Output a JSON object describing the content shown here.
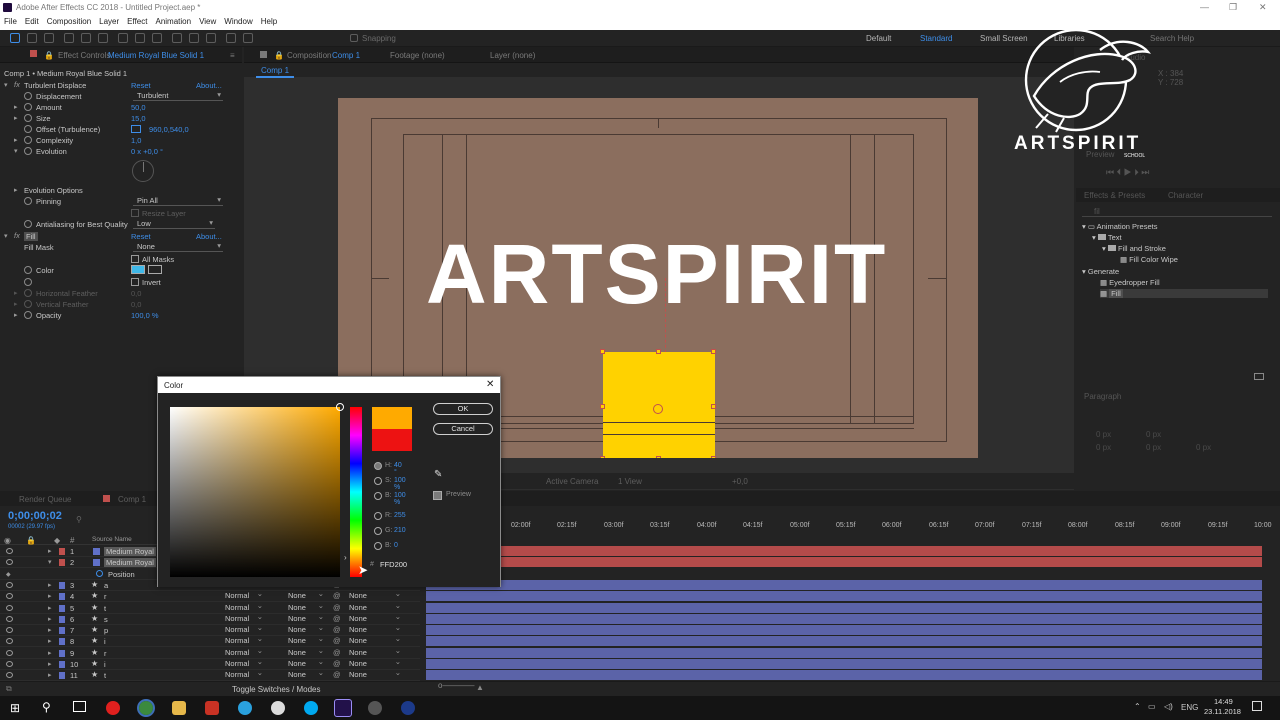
{
  "window": {
    "title": "Adobe After Effects CC 2018 - Untitled Project.aep *"
  },
  "menu": [
    "File",
    "Edit",
    "Composition",
    "Layer",
    "Effect",
    "Animation",
    "View",
    "Window",
    "Help"
  ],
  "toolbar": {
    "snapping": "Snapping",
    "workspaces": [
      "Default",
      "Standard",
      "Small Screen",
      "Libraries"
    ],
    "active_workspace": "Standard",
    "search_placeholder": "Search Help"
  },
  "effect_controls": {
    "tab": "Effect Controls",
    "tab_layer": "Medium Royal Blue Solid 1",
    "header": "Comp 1 • Medium Royal Blue Solid 1",
    "turbulent": {
      "name": "Turbulent Displace",
      "reset": "Reset",
      "about": "About...",
      "displacement_label": "Displacement",
      "displacement_value": "Turbulent",
      "amount_label": "Amount",
      "amount_value": "50,0",
      "size_label": "Size",
      "size_value": "15,0",
      "offset_label": "Offset (Turbulence)",
      "offset_value": "960,0,540,0",
      "complexity_label": "Complexity",
      "complexity_value": "1,0",
      "evolution_label": "Evolution",
      "evolution_value": "0 x +0,0 °",
      "evolution_options": "Evolution Options",
      "pinning_label": "Pinning",
      "pinning_value": "Pin All",
      "resize_layer": "Resize Layer",
      "antialias_label": "Antialiasing for Best Quality",
      "antialias_value": "Low"
    },
    "fill": {
      "name": "Fill",
      "reset": "Reset",
      "about": "About...",
      "mask_label": "Fill Mask",
      "mask_value": "None",
      "all_masks": "All Masks",
      "color_label": "Color",
      "invert": "Invert",
      "h_feather": "Horizontal Feather",
      "h_feather_value": "0,0",
      "v_feather": "Vertical Feather",
      "v_feather_value": "0,0",
      "opacity_label": "Opacity",
      "opacity_value": "100,0 %"
    }
  },
  "composition": {
    "tab": "Composition",
    "tab_comp": "Comp 1",
    "footage_tab": "Footage (none)",
    "layer_tab": "Layer (none)",
    "sub_tab": "Comp 1",
    "text": "ARTSPIRIT",
    "footer_camera": "Active Camera",
    "footer_view": "1 View",
    "footer_offset": "+0,0"
  },
  "right_panel": {
    "info_x": "X : 384",
    "info_y": "Y : 728",
    "preview_tab": "Preview",
    "audio_tab": "Audio",
    "effects_tab": "Effects & Presets",
    "character_tab": "Character",
    "search": "fil",
    "tree": [
      "Animation Presets",
      "Text",
      "Fill and Stroke",
      "Fill Color Wipe",
      "Generate",
      "Eyedropper Fill",
      "Fill"
    ],
    "paragraph_tab": "Paragraph",
    "para_values": [
      "0 px",
      "0 px",
      "0 px",
      "0 px",
      "0 px"
    ]
  },
  "logo": {
    "brand": "ARTSPIRIT",
    "sub": "SCHOOL"
  },
  "color_dialog": {
    "title": "Color",
    "ok": "OK",
    "cancel": "Cancel",
    "preview": "Preview",
    "h_label": "H:",
    "h_value": "40 °",
    "s_label": "S:",
    "s_value": "100 %",
    "b_label": "B:",
    "b_value": "100 %",
    "r_label": "R:",
    "r_value": "255",
    "g_label": "G:",
    "g_value": "210",
    "bb_label": "B:",
    "bb_value": "0",
    "hex_label": "#",
    "hex_value": "FFD200",
    "new_color": "#ffaa00",
    "old_color": "#ed1212"
  },
  "timeline": {
    "render_queue": "Render Queue",
    "comp_tab": "Comp 1",
    "timecode": "0;00;00;02",
    "fps": "00002 (29.97 fps)",
    "col_source": "Source Name",
    "layers": [
      {
        "num": "1",
        "name": "Medium Royal",
        "kind": "solid",
        "color": "#c0504d"
      },
      {
        "num": "2",
        "name": "Medium Royal",
        "kind": "solid",
        "color": "#c0504d"
      },
      {
        "num": "",
        "name": "Position",
        "kind": "prop",
        "color": ""
      },
      {
        "num": "3",
        "name": "a",
        "kind": "text",
        "color": "#6070c8"
      },
      {
        "num": "4",
        "name": "r",
        "kind": "text",
        "color": "#6070c8"
      },
      {
        "num": "5",
        "name": "t",
        "kind": "text",
        "color": "#6070c8"
      },
      {
        "num": "6",
        "name": "s",
        "kind": "text",
        "color": "#6070c8"
      },
      {
        "num": "7",
        "name": "p",
        "kind": "text",
        "color": "#6070c8"
      },
      {
        "num": "8",
        "name": "i",
        "kind": "text",
        "color": "#6070c8"
      },
      {
        "num": "9",
        "name": "r",
        "kind": "text",
        "color": "#6070c8"
      },
      {
        "num": "10",
        "name": "i",
        "kind": "text",
        "color": "#6070c8"
      },
      {
        "num": "11",
        "name": "t",
        "kind": "text",
        "color": "#6070c8"
      }
    ],
    "mode": "Normal",
    "none": "None",
    "ruler": [
      "00f",
      "01:15f",
      "02:00f",
      "02:15f",
      "03:00f",
      "03:15f",
      "04:00f",
      "04:15f",
      "05:00f",
      "05:15f",
      "06:00f",
      "06:15f",
      "07:00f",
      "07:15f",
      "08:00f",
      "08:15f",
      "09:00f",
      "09:15f",
      "10:00"
    ],
    "toggle": "Toggle Switches / Modes"
  },
  "taskbar": {
    "lang": "ENG",
    "time": "14:49",
    "date": "23.11.2018"
  }
}
